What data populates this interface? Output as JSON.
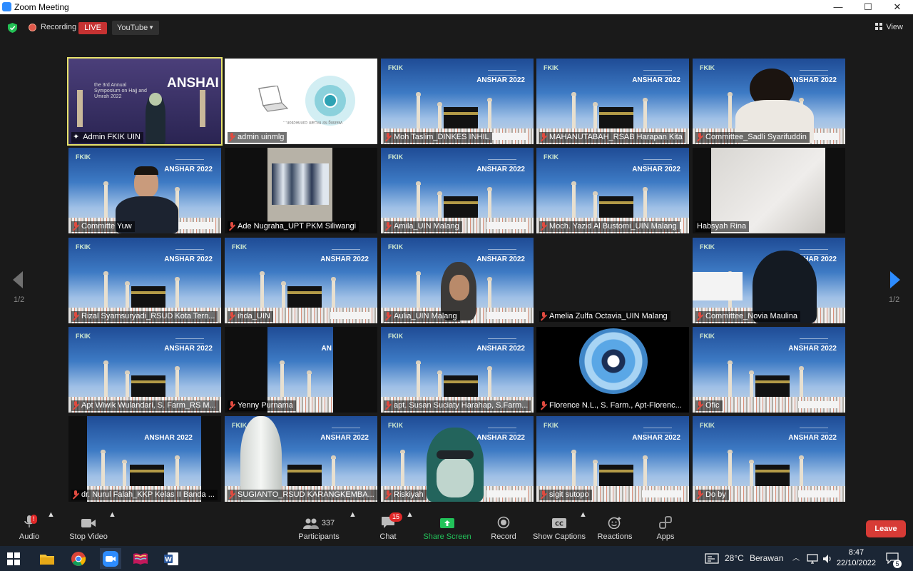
{
  "window": {
    "title": "Zoom Meeting",
    "minimize": "—",
    "maximize": "☐",
    "close": "✕"
  },
  "topbar": {
    "recording": "Recording",
    "live": "LIVE",
    "stream_target": "YouTube",
    "view": "View"
  },
  "pagination": {
    "left": "1/2",
    "right": "1/2"
  },
  "participants": [
    "Admin FKIK UIN",
    "admin uinmlg",
    "Moh Taslim_DINKES INHIL",
    "MAHANUTABAH_RSAB Harapan Kita",
    "Committee_Sadli Syarifuddin",
    "Committe Yuw",
    "Ade Nugraha_UPT PKM Siliwangi",
    "Amila_UIN Malang",
    "Moch. Yazid Al Bustomi_UIN Malang",
    "Habsyah Rina",
    "Rizal Syamsuryadi_RSUD Kota Tern...",
    "ihda_UIN",
    "Aulia_UIN Malang",
    "Amelia Zulfa Octavia_UIN Malang",
    "Committee_Novia Maulina",
    "Apt Wiwik Wulandari, S. Farm_RS M...",
    "Yenny Purnama",
    "apt. Susan Suciaty Harahap, S.Farm...",
    "Florence N.L., S. Farm., Apt-Florenc...",
    "Ofic",
    "dr. Nurul Falah_KKP Kelas II Banda ...",
    "SUGIANTO_RSUD KARANGKEMBA...",
    "Riskiyah",
    "sigit sutopo",
    "Do by"
  ],
  "screen_text": {
    "brand": "FKIK",
    "event": "ANSHAR 2022",
    "event_big": "ANSHAI",
    "event_sub": "the 3rd Annual Symposium on Hajj and Umrah 2022",
    "waiting": "Waiting for hiCam connection..."
  },
  "toolbar": {
    "audio": "Audio",
    "stop_video": "Stop Video",
    "participants": "Participants",
    "participants_count": "337",
    "chat": "Chat",
    "chat_badge": "15",
    "share_screen": "Share Screen",
    "record": "Record",
    "show_captions": "Show Captions",
    "reactions": "Reactions",
    "apps": "Apps",
    "leave": "Leave",
    "audio_badge": "!"
  },
  "taskbar": {
    "temperature": "28°C",
    "weather": "Berawan",
    "time": "8:47",
    "date": "22/10/2022",
    "notifications": "5"
  },
  "colors": {
    "live": "#c63232",
    "share": "#22c35a",
    "leave": "#d73b36",
    "active_speaker": "#e8e36b",
    "arrow": "#2d8cff"
  }
}
